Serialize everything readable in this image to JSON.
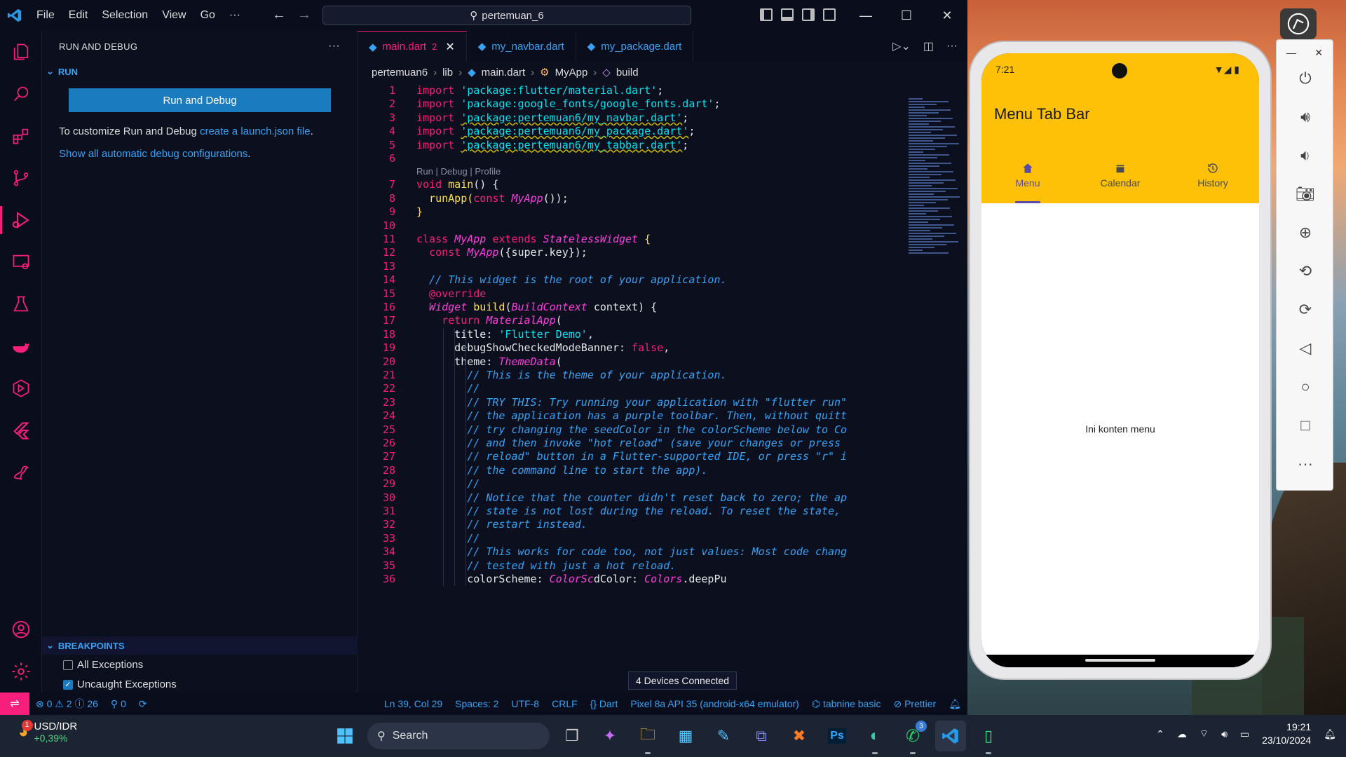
{
  "colors": {
    "accent": "#f71e7c",
    "link": "#36a3f5",
    "phone_appbar": "#ffc107",
    "tab_selected": "#5b4ba8"
  },
  "titlebar": {
    "menu": [
      "File",
      "Edit",
      "Selection",
      "View",
      "Go",
      "···"
    ],
    "search": "pertemuan_6",
    "window_controls": [
      "minimize-icon",
      "maximize-icon",
      "close-icon"
    ]
  },
  "activity": {
    "items": [
      "explorer-icon",
      "search-icon",
      "extensions-icon",
      "source-control-icon",
      "run-debug-icon",
      "remote-explorer-icon",
      "testing-icon",
      "docker-icon",
      "gitlens-icon",
      "flutter-icon",
      "accounts-icon",
      "settings-icon"
    ]
  },
  "sidebar": {
    "header": "RUN AND DEBUG",
    "more": "···",
    "section": "RUN",
    "run_button": "Run and Debug",
    "customize_text": "To customize Run and Debug ",
    "customize_link": "create a launch.json file",
    "customize_end": ".",
    "show_all": "Show all automatic debug configurations",
    "show_all_end": ".",
    "breakpoints_header": "BREAKPOINTS",
    "breakpoints": [
      {
        "label": "All Exceptions",
        "checked": false
      },
      {
        "label": "Uncaught Exceptions",
        "checked": true
      }
    ]
  },
  "editor": {
    "tabs": [
      {
        "label": "main.dart",
        "badge": "2",
        "active": true
      },
      {
        "label": "my_navbar.dart"
      },
      {
        "label": "my_package.dart"
      }
    ],
    "close": "✕",
    "breadcrumb": [
      "pertemuan6",
      "lib",
      "main.dart",
      "MyApp",
      "build"
    ],
    "codelens": "Run | Debug | Profile",
    "line_numbers": [
      "1",
      "2",
      "3",
      "4",
      "5",
      "6",
      "7",
      "8",
      "9",
      "10",
      "11",
      "12",
      "13",
      "14",
      "15",
      "16",
      "17",
      "18",
      "19",
      "20",
      "21",
      "22",
      "23",
      "24",
      "25",
      "26",
      "27",
      "28",
      "29",
      "30",
      "31",
      "32",
      "33",
      "34",
      "35",
      "36"
    ],
    "code": {
      "l1a": "import ",
      "l1b": "'package:flutter/material.dart'",
      "l1c": ";",
      "l2a": "import ",
      "l2b": "'package:google_fonts/google_fonts.dart'",
      "l2c": ";",
      "l3a": "import ",
      "l3b": "'package:pertemuan6/my_navbar.dart'",
      "l3c": ";",
      "l4a": "import ",
      "l4b": "'package:pertemuan6/my_package.dart'",
      "l4c": ";",
      "l5a": "import ",
      "l5b": "'package:pertemuan6/my_tabbar.dart'",
      "l5c": ";",
      "l7a": "void ",
      "l7b": "main",
      "l7c": "() {",
      "l8a": "  runApp(",
      "l8b": "const ",
      "l8c": "MyApp",
      "l8d": "());",
      "l9": "}",
      "l11a": "class ",
      "l11b": "MyApp ",
      "l11c": "extends ",
      "l11d": "StatelessWidget ",
      "l11e": "{",
      "l12a": "  const ",
      "l12b": "MyApp",
      "l12c": "({super.key});",
      "l14": "  // This widget is the root of your application.",
      "l15": "  @override",
      "l16a": "  Widget ",
      "l16b": "build",
      "l16c": "(",
      "l16d": "BuildContext ",
      "l16e": "context) {",
      "l17a": "    return ",
      "l17b": "MaterialApp",
      "l17c": "(",
      "l18a": "      title: ",
      "l18b": "'Flutter Demo'",
      "l18c": ",",
      "l19a": "      debugShowCheckedModeBanner: ",
      "l19b": "false",
      "l19c": ",",
      "l20a": "      theme: ",
      "l20b": "ThemeData",
      "l20c": "(",
      "l21": "        // This is the theme of your application.",
      "l22": "        //",
      "l23": "        // TRY THIS: Try running your application with \"flutter run\"",
      "l24": "        // the application has a purple toolbar. Then, without quitt",
      "l25": "        // try changing the seedColor in the colorScheme below to Co",
      "l26": "        // and then invoke \"hot reload\" (save your changes or press ",
      "l27": "        // reload\" button in a Flutter-supported IDE, or press \"r\" i",
      "l28": "        // the command line to start the app).",
      "l29": "        //",
      "l30": "        // Notice that the counter didn't reset back to zero; the ap",
      "l31": "        // state is not lost during the reload. To reset the state, ",
      "l32": "        // restart instead.",
      "l33": "        //",
      "l34": "        // This works for code too, not just values: Most code chang",
      "l35": "        // tested with just a hot reload.",
      "l36a": "        colorScheme: ",
      "l36b": "ColorSc",
      "l36c": "dColor: ",
      "l36d": "Colors",
      "l36e": ".deepPu"
    },
    "tooltip": "4 Devices Connected"
  },
  "statusbar": {
    "errors": "0",
    "warnings": "2",
    "info": "26",
    "ports": "0",
    "position": "Ln 39, Col 29",
    "spaces": "Spaces: 2",
    "encoding": "UTF-8",
    "eol": "CRLF",
    "language": "Dart",
    "device": "Pixel 8a API 35 (android-x64 emulator)",
    "tabnine": "tabnine basic",
    "prettier": "Prettier"
  },
  "phone": {
    "time": "7:21",
    "title": "Menu Tab Bar",
    "tabs": [
      {
        "label": "Menu",
        "icon": "home-icon",
        "selected": true
      },
      {
        "label": "Calendar",
        "icon": "calendar-icon"
      },
      {
        "label": "History",
        "icon": "history-icon"
      }
    ],
    "content": "Ini konten menu"
  },
  "emulator_controls": {
    "min": "—",
    "close": "✕",
    "buttons": [
      "power-icon",
      "volume-up-icon",
      "volume-down-icon",
      "camera-icon",
      "zoom-icon",
      "rotate-left-icon",
      "rotate-right-icon",
      "back-icon",
      "home-icon",
      "overview-icon",
      "more-icon"
    ]
  },
  "taskbar": {
    "ticker": "USD/IDR",
    "change": "+0,39%",
    "ticker_badge": "1",
    "search": "Search",
    "whatsapp_badge": "3",
    "time": "19:21",
    "date": "23/10/2024"
  }
}
